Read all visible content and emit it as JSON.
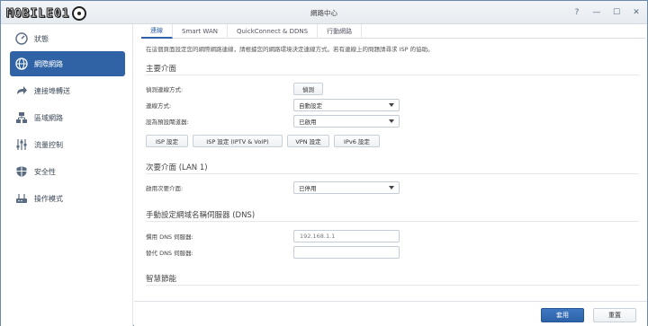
{
  "window": {
    "title": "網路中心",
    "logo_text": "MOBILE01"
  },
  "sidebar": {
    "items": [
      {
        "label": "狀態",
        "icon": "dashboard-icon"
      },
      {
        "label": "網際網路",
        "icon": "globe-icon",
        "active": true
      },
      {
        "label": "連接埠轉送",
        "icon": "forward-arrow-icon"
      },
      {
        "label": "區域網路",
        "icon": "network-icon"
      },
      {
        "label": "流量控制",
        "icon": "sliders-icon"
      },
      {
        "label": "安全性",
        "icon": "shield-icon"
      },
      {
        "label": "操作模式",
        "icon": "router-icon"
      }
    ]
  },
  "tabs": [
    "連線",
    "Smart WAN",
    "QuickConnect & DDNS",
    "行動網路"
  ],
  "description": "在這個頁面設定您的網際網路連線，請根據您的網路環境決定連線方式。若有連線上的問題請尋求 ISP 的協助。",
  "primary": {
    "title": "主要介面",
    "detect_label": "偵測連線方式:",
    "detect_button": "偵測",
    "conn_label": "連線方式:",
    "conn_value": "自動設定",
    "default_gw_label": "設為預設閘道器:",
    "default_gw_value": "已啟用",
    "buttons": [
      "ISP 設定",
      "ISP 設定 (IPTV & VoIP)",
      "VPN 設定",
      "IPv6 設定"
    ]
  },
  "secondary": {
    "title": "次要介面 (LAN 1)",
    "enable_label": "啟用次要介面:",
    "enable_value": "已停用"
  },
  "dns": {
    "title": "手動設定網域名稱伺服器 (DNS)",
    "preferred_label": "慣用 DNS 伺服器:",
    "preferred_value": "192.168.1.1",
    "alternate_label": "替代 DNS 伺服器:",
    "alternate_value": ""
  },
  "smart": {
    "title": "智慧節能"
  },
  "footer": {
    "apply": "套用",
    "reset": "重置"
  }
}
